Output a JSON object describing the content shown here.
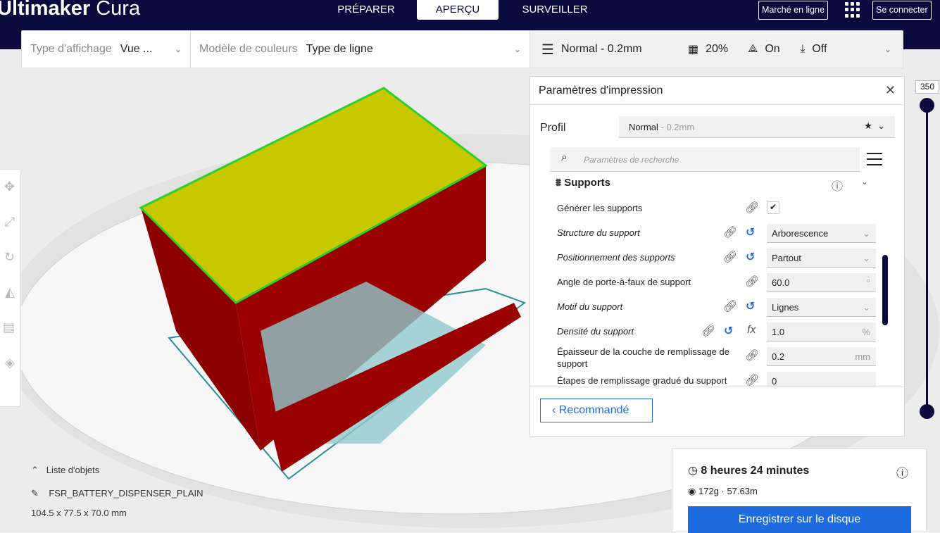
{
  "header": {
    "logo_bold": "Ultimaker",
    "logo_light": " Cura",
    "tabs": [
      "PRÉPARER",
      "APERÇU",
      "SURVEILLER"
    ],
    "marketplace": "Marché en ligne",
    "signin": "Se connecter"
  },
  "toolbar": {
    "view_type_label": "Type d'affichage",
    "view_type_value": "Vue ...",
    "color_label": "Modèle de couleurs",
    "color_value": "Type de ligne",
    "profile": "Normal - 0.2mm",
    "infill": "20%",
    "support": "On",
    "adhesion": "Off"
  },
  "panel": {
    "title": "Paramètres d'impression",
    "profile_label": "Profil",
    "profile_name": "Normal",
    "profile_detail": " - 0.2mm",
    "search_placeholder": "Paramètres de recherche",
    "category": "Supports",
    "settings": [
      {
        "name": "Générer les supports",
        "italic": false,
        "value": "",
        "checkbox": true
      },
      {
        "name": "Structure du support",
        "italic": true,
        "value": "Arborescence",
        "dropdown": true,
        "reset": true
      },
      {
        "name": "Positionnement des supports",
        "italic": true,
        "value": "Partout",
        "dropdown": true,
        "reset": true
      },
      {
        "name": "Angle de porte-à-faux de support",
        "italic": false,
        "value": "60.0",
        "unit": "°"
      },
      {
        "name": "Motif du support",
        "italic": true,
        "value": "Lignes",
        "dropdown": true,
        "reset": true
      },
      {
        "name": "Densité du support",
        "italic": true,
        "value": "1.0",
        "unit": "%",
        "reset": true,
        "formula": true
      },
      {
        "name": "Épaisseur de la couche de remplissage de support",
        "italic": false,
        "value": "0.2",
        "unit": "mm"
      },
      {
        "name": "Étapes de remplissage gradué du support",
        "italic": false,
        "value": "0"
      }
    ],
    "recommended": "Recommandé"
  },
  "layer_slider": {
    "top_value": "350"
  },
  "objects": {
    "title": "Liste d'objets",
    "name": "FSR_BATTERY_DISPENSER_PLAIN",
    "dims": "104.5 x 77.5 x 70.0 mm"
  },
  "print_info": {
    "time": "8 heures 24 minutes",
    "material": "172g · 57.63m",
    "save": "Enregistrer sur le disque"
  },
  "colors": {
    "header": "#0b0a3e",
    "accent": "#1e6be0"
  }
}
